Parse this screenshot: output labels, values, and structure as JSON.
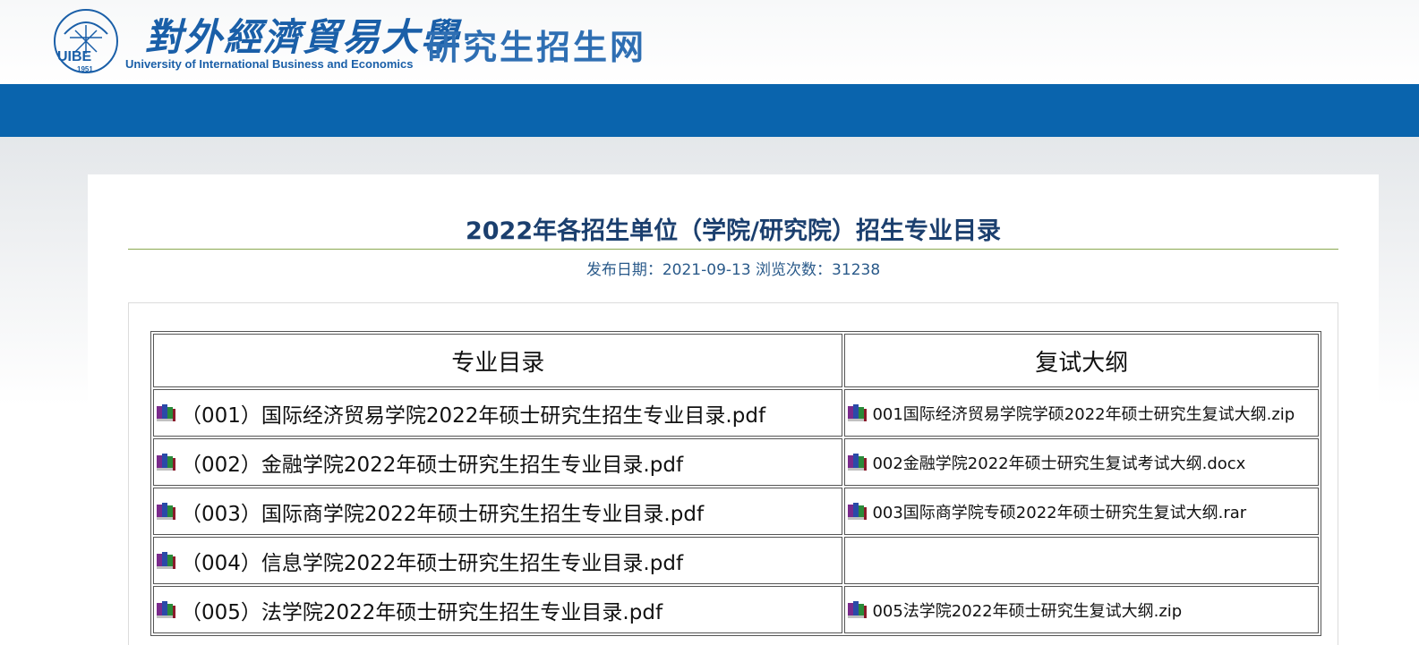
{
  "header": {
    "calligraphy": "對外經濟貿易大學",
    "university_en": "University of International Business and Economics",
    "seal_year": "1951",
    "site_name": "研究生招生网"
  },
  "article": {
    "title": "2022年各招生单位（学院/研究院）招生专业目录",
    "meta": "发布日期：2021-09-13 浏览次数：31238"
  },
  "table": {
    "headers": [
      "专业目录",
      "复试大纲"
    ],
    "rows": [
      {
        "catalog": "（001）国际经济贸易学院2022年硕士研究生招生专业目录.pdf",
        "outline": "001国际经济贸易学院学硕2022年硕士研究生复试大纲.zip"
      },
      {
        "catalog": "（002）金融学院2022年硕士研究生招生专业目录.pdf",
        "outline": "002金融学院2022年硕士研究生复试考试大纲.docx"
      },
      {
        "catalog": "（003）国际商学院2022年硕士研究生招生专业目录.pdf",
        "outline": "003国际商学院专硕2022年硕士研究生复试大纲.rar"
      },
      {
        "catalog": "（004）信息学院2022年硕士研究生招生专业目录.pdf",
        "outline": ""
      },
      {
        "catalog": "（005）法学院2022年硕士研究生招生专业目录.pdf",
        "outline": "005法学院2022年硕士研究生复试大纲.zip"
      }
    ]
  },
  "colors": {
    "nav": "#0a64ad",
    "title": "#1b3f6e",
    "brand": "#1a5fa8"
  },
  "icons": {
    "file": "book-stack-icon"
  }
}
